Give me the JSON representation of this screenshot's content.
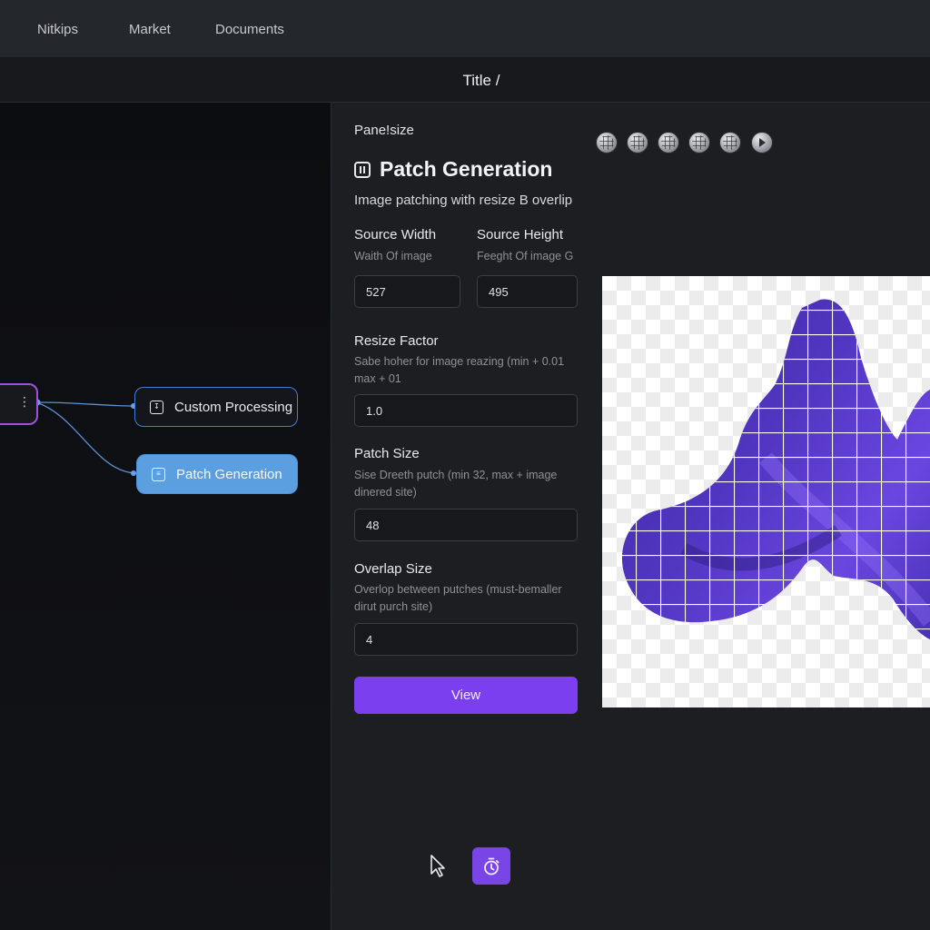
{
  "nav": {
    "items": [
      "Nitkips",
      "Market",
      "Documents"
    ]
  },
  "title_bar": {
    "breadcrumb": "Title /"
  },
  "canvas": {
    "nodes": [
      {
        "label": "Custom Processing",
        "icon": "download-box-icon"
      },
      {
        "label": "Patch Generation",
        "icon": "document-icon",
        "selected": true
      }
    ],
    "source_node_icon": "kebab-menu-icon"
  },
  "panel": {
    "label": "Pane!size",
    "title": "Patch Generation",
    "title_icon": "patch-icon",
    "description": "Image patching with resize B overlip",
    "fields": {
      "source_width": {
        "label": "Source Width",
        "help": "Waith Of image",
        "value": "527"
      },
      "source_height": {
        "label": "Source Height",
        "help": "Feeght Of image G",
        "value": "495"
      },
      "resize_factor": {
        "label": "Resize Factor",
        "help": "Sabe hoher for image reazing (min + 0.01 max + 01",
        "value": "1.0"
      },
      "patch_size": {
        "label": "Patch Size",
        "help": "Sise Dreeth putch (min 32, max + image dinered site)",
        "value": "48"
      },
      "overlap_size": {
        "label": "Overlap Size",
        "help": "Overlop between putches (must-bemaller dirut purch site)",
        "value": "4"
      }
    },
    "view_button": "View"
  },
  "preview": {
    "toolbar_icons": [
      "grid-sphere-icon",
      "grid-sphere-icon",
      "grid-sphere-icon",
      "grid-sphere-icon",
      "grid-sphere-icon",
      "play-icon"
    ],
    "shape_color": "#4a2fa8",
    "grid_line_color": "#ffffff"
  },
  "bottom": {
    "cursor_icon": "pointer-cursor-icon",
    "action_icon": "timer-icon"
  },
  "colors": {
    "accent": "#7b3ff0",
    "node_selected": "#5c9fe0",
    "node_border": "#3f7fd6",
    "source_node_border": "#a050e0"
  }
}
